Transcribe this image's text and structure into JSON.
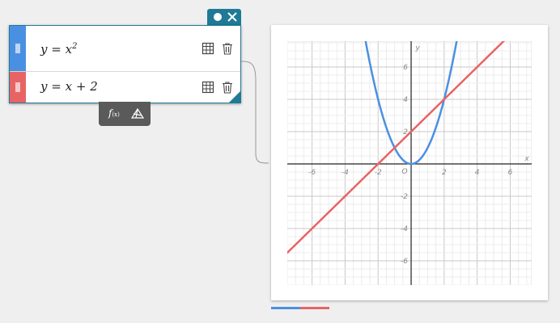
{
  "expressions": [
    {
      "lhs": "y",
      "eq": "=",
      "rhs": "x",
      "sup": "2",
      "color": "#4a90e2"
    },
    {
      "lhs": "y",
      "eq": "=",
      "rhs": "x + 2",
      "sup": "",
      "color": "#e86464"
    }
  ],
  "toolbar": {
    "fx_label": "f",
    "fx_sub": "(x)"
  },
  "graph": {
    "x_label": "x",
    "y_label": "y",
    "origin_label": "O",
    "x_ticks": [
      "-6",
      "-4",
      "-2",
      "2",
      "4",
      "6"
    ],
    "y_ticks": [
      "6",
      "4",
      "2",
      "-2",
      "-4",
      "-6"
    ]
  },
  "colors": {
    "accent": "#1f7a96",
    "curve1": "#4a90e2",
    "curve2": "#e86464"
  },
  "chart_data": {
    "type": "line",
    "xlim": [
      -7.5,
      7.3
    ],
    "ylim": [
      -7.5,
      7.6
    ],
    "grid": true,
    "series": [
      {
        "expr": "y=x^2",
        "color": "#4a90e2"
      },
      {
        "expr": "y=x+2",
        "color": "#e86464"
      }
    ]
  }
}
